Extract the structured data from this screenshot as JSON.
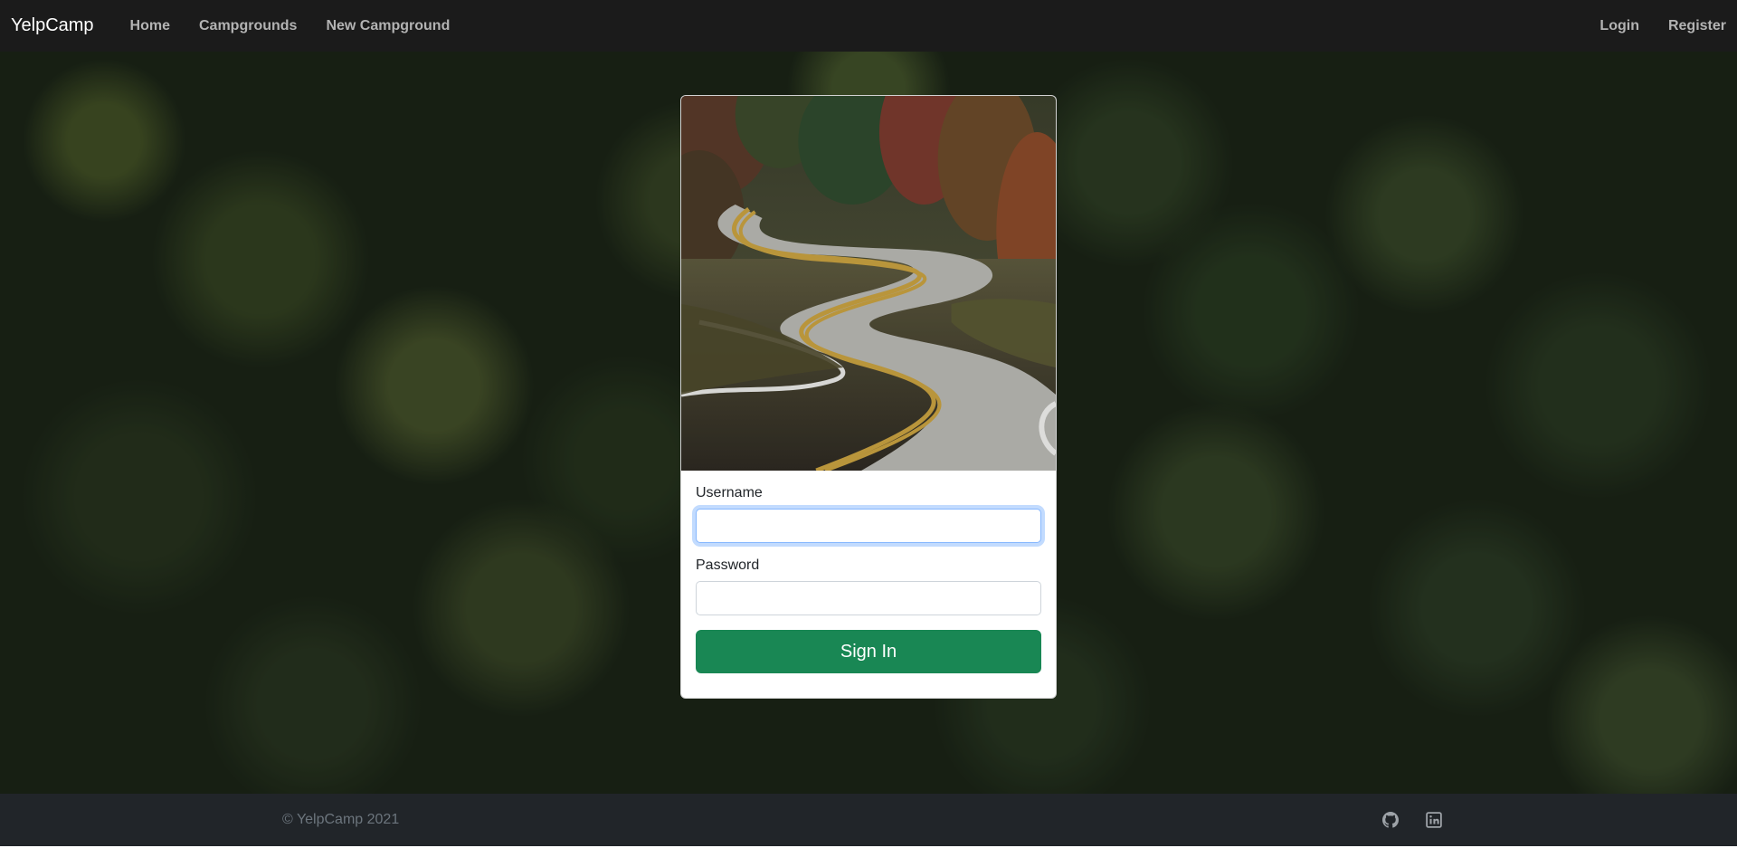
{
  "navbar": {
    "brand": "YelpCamp",
    "links": [
      {
        "label": "Home"
      },
      {
        "label": "Campgrounds"
      },
      {
        "label": "New Campground"
      }
    ],
    "right_links": [
      {
        "label": "Login"
      },
      {
        "label": "Register"
      }
    ]
  },
  "login_card": {
    "username_label": "Username",
    "username_value": "",
    "password_label": "Password",
    "password_value": "",
    "submit_label": "Sign In"
  },
  "footer": {
    "copyright": "© YelpCamp 2021",
    "icons": [
      "github-icon",
      "linkedin-icon"
    ]
  },
  "colors": {
    "navbar_bg": "#1b1b1b",
    "footer_bg": "#212529",
    "primary_button": "#198754",
    "focus_ring": "#86b7fe"
  }
}
